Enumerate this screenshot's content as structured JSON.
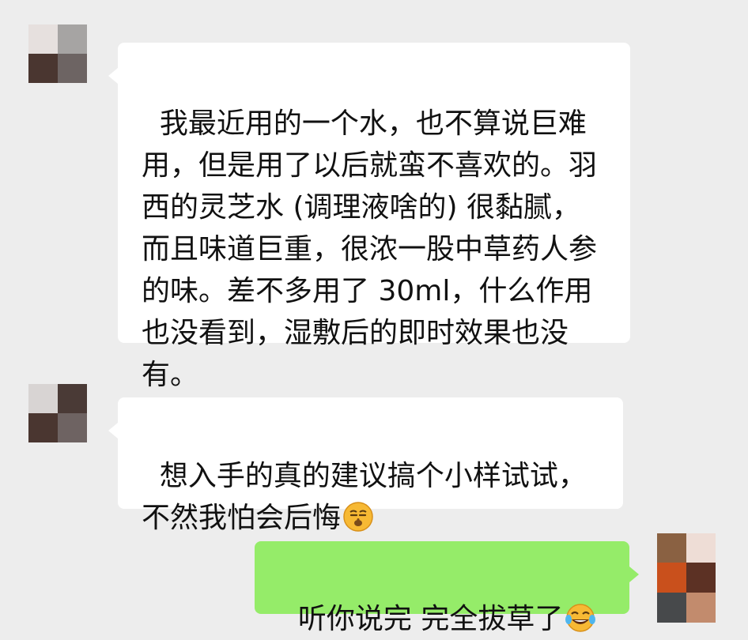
{
  "messages": [
    {
      "side": "left",
      "text": "我最近用的一个水，也不算说巨难用，但是用了以后就蛮不喜欢的。羽西的灵芝水 (调理液啥的) 很黏腻，而且味道巨重，很浓一股中草药人参的味。差不多用了 30ml，什么作用也没看到，湿敷后的即时效果也没有。"
    },
    {
      "side": "left",
      "text": "想入手的真的建议搞个小样试试，不然我怕会后悔",
      "emoji": "hush-face-icon"
    },
    {
      "side": "right",
      "text": "听你说完 完全拔草了",
      "emoji": "tears-of-joy-icon"
    }
  ],
  "colors": {
    "background": "#ededed",
    "incoming_bubble": "#ffffff",
    "outgoing_bubble": "#95ec69"
  }
}
